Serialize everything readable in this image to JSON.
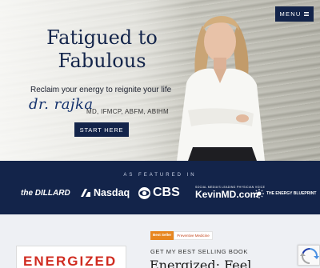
{
  "header": {
    "menu_label": "MENU"
  },
  "hero": {
    "title_line1": "Fatigued to",
    "title_line2": "Fabulous",
    "tagline": "Reclaim your energy to reignite your life",
    "signature": "dr. rajka",
    "credentials": "MD, IFMCP, ABFM, ABIHM",
    "cta_label": "START HERE"
  },
  "featured": {
    "label": "AS FEATURED IN",
    "logos": {
      "dillard": "the DILLARD",
      "nasdaq": "Nasdaq",
      "cbs": "CBS",
      "kevin_small": "SOCIAL MEDIA'S LEADING PHYSICIAN VOICE",
      "kevin": "KevinMD.com",
      "blueprint": "THE ENERGY BLUEPRINT"
    }
  },
  "book": {
    "badge_primary": "Best Seller",
    "badge_category": "Preventive Medicine",
    "section_label": "GET MY BEST SELLING BOOK",
    "title": "Energized: Feel",
    "cover_title": "ENERGIZED"
  },
  "colors": {
    "navy": "#13244a",
    "accent_orange": "#e7861f",
    "cover_red": "#d02b20"
  }
}
